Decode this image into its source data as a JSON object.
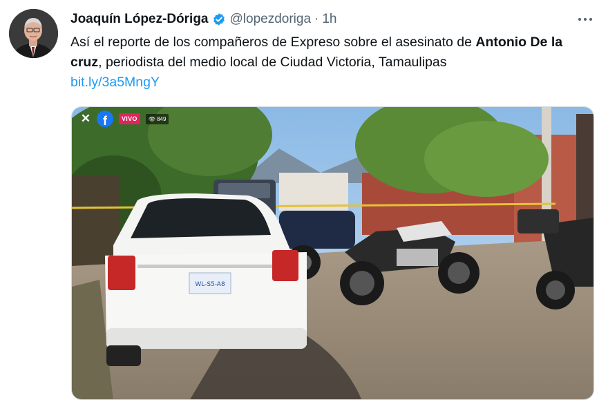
{
  "tweet": {
    "author_name": "Joaquín López-Dóriga",
    "handle": "@lopezdoriga",
    "separator": "·",
    "time": "1h",
    "text": {
      "part1": "Así el reporte de los compañeros de Expreso sobre el asesinato de ",
      "bold1": "Antonio De la cruz",
      "part2": ", periodista del medio local de Ciudad Victoria, Tamaulipas",
      "link": "bit.ly/3a5MngY"
    }
  },
  "media": {
    "overlay": {
      "close": "✕",
      "fb_letter": "f",
      "live_label": "VIVO",
      "viewers": "👁 849"
    },
    "plate_text": "WL-S5-A8"
  },
  "colors": {
    "link": "#1d9bf0",
    "verified": "#1d9bf0",
    "secondary_text": "#536471",
    "live": "#e0245e",
    "facebook": "#1877f2"
  },
  "icons": {
    "verified": "verified-badge-icon",
    "more": "more-options-icon",
    "close": "close-icon",
    "facebook": "facebook-icon"
  }
}
